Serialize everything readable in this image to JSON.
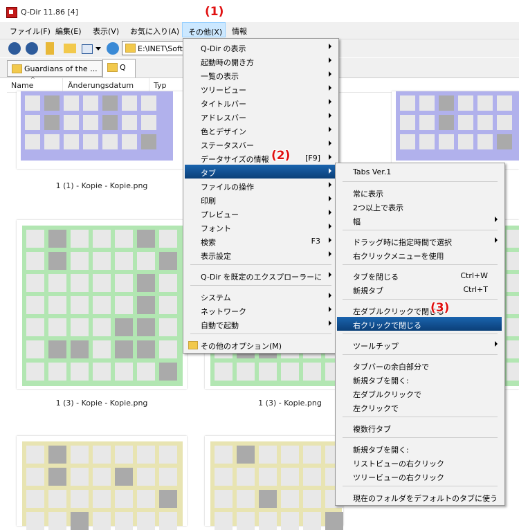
{
  "window": {
    "title": "Q-Dir 11.86 [4]"
  },
  "menubar": [
    "ファイル(F)",
    "編集(E)",
    "表示(V)",
    "お気に入り(A)",
    "その他(X)",
    "情報"
  ],
  "address": {
    "value": "E:\\INET\\Soft"
  },
  "tabs": [
    {
      "label": "Guardians of the ..."
    },
    {
      "label": "Q"
    }
  ],
  "columns": [
    "Name",
    "Änderungsdatum",
    "Typ"
  ],
  "files": [
    {
      "caption": "1 (1) - Kopie - Kopie.png",
      "color": "#b1b1ec"
    },
    {
      "caption": "1 (3) - Kopie - Kopie.png",
      "color": "#b2e6b2"
    },
    {
      "caption": "1 (3) - Kopie.png",
      "color": "#b2e6b2"
    },
    {
      "caption": "",
      "color": "#e8e4b2"
    }
  ],
  "menu_sonota": [
    {
      "label": "Q-Dir の表示",
      "arrow": true
    },
    {
      "label": "起動時の開き方",
      "arrow": true
    },
    {
      "label": "一覧の表示",
      "arrow": true
    },
    {
      "label": "ツリービュー",
      "arrow": true
    },
    {
      "label": "タイトルバー",
      "arrow": true
    },
    {
      "label": "アドレスバー",
      "arrow": true
    },
    {
      "label": "色とデザイン",
      "arrow": true
    },
    {
      "label": "ステータスバー",
      "arrow": true
    },
    {
      "label": "データサイズの情報",
      "accel": "[F9]",
      "arrow": true
    },
    {
      "label": "タブ",
      "arrow": true,
      "highlight": true
    },
    {
      "label": "ファイルの操作",
      "arrow": true
    },
    {
      "label": "印刷",
      "arrow": true
    },
    {
      "label": "プレビュー",
      "arrow": true
    },
    {
      "label": "フォント",
      "arrow": true
    },
    {
      "label": "検索",
      "accel": "F3",
      "arrow": true
    },
    {
      "label": "表示設定",
      "arrow": true
    },
    {
      "separator": true
    },
    {
      "label": "Q-Dir を既定のエクスプローラーに",
      "arrow": true
    },
    {
      "separator": true
    },
    {
      "label": "システム",
      "arrow": true
    },
    {
      "label": "ネットワーク",
      "arrow": true
    },
    {
      "label": "自動で起動",
      "arrow": true
    },
    {
      "separator": true
    },
    {
      "label": "その他のオプション(M)",
      "icon": "folder-icon"
    }
  ],
  "menu_tab": [
    {
      "label": "Tabs Ver.1"
    },
    {
      "separator": true
    },
    {
      "label": "常に表示"
    },
    {
      "label": "2つ以上で表示"
    },
    {
      "label": "幅",
      "arrow": true
    },
    {
      "separator": true
    },
    {
      "label": "ドラッグ時に指定時間で選択",
      "arrow": true
    },
    {
      "label": "右クリックメニューを使用"
    },
    {
      "separator": true
    },
    {
      "label": "タブを閉じる",
      "accel": "Ctrl+W"
    },
    {
      "label": "新規タブ",
      "accel": "Ctrl+T"
    },
    {
      "separator": true
    },
    {
      "label": "左ダブルクリックで閉じる"
    },
    {
      "label": "右クリックで閉じる",
      "highlight": true
    },
    {
      "separator": true
    },
    {
      "label": "ツールチップ",
      "arrow": true
    },
    {
      "separator": true
    },
    {
      "label": "タブバーの余白部分で"
    },
    {
      "label": "新規タブを開く:"
    },
    {
      "label": "左ダブルクリックで"
    },
    {
      "label": "左クリックで"
    },
    {
      "separator": true
    },
    {
      "label": "複数行タブ"
    },
    {
      "separator": true
    },
    {
      "label": "新規タブを開く:"
    },
    {
      "label": "リストビューの右クリック"
    },
    {
      "label": "ツリービューの右クリック"
    },
    {
      "separator": true
    },
    {
      "label": "現在のフォルダをデフォルトのタブに使う"
    }
  ],
  "annotations": [
    "(1)",
    "(2)",
    "(3)"
  ],
  "colors": {
    "highlight": "#0d4f91",
    "annotation": "#e01010"
  }
}
